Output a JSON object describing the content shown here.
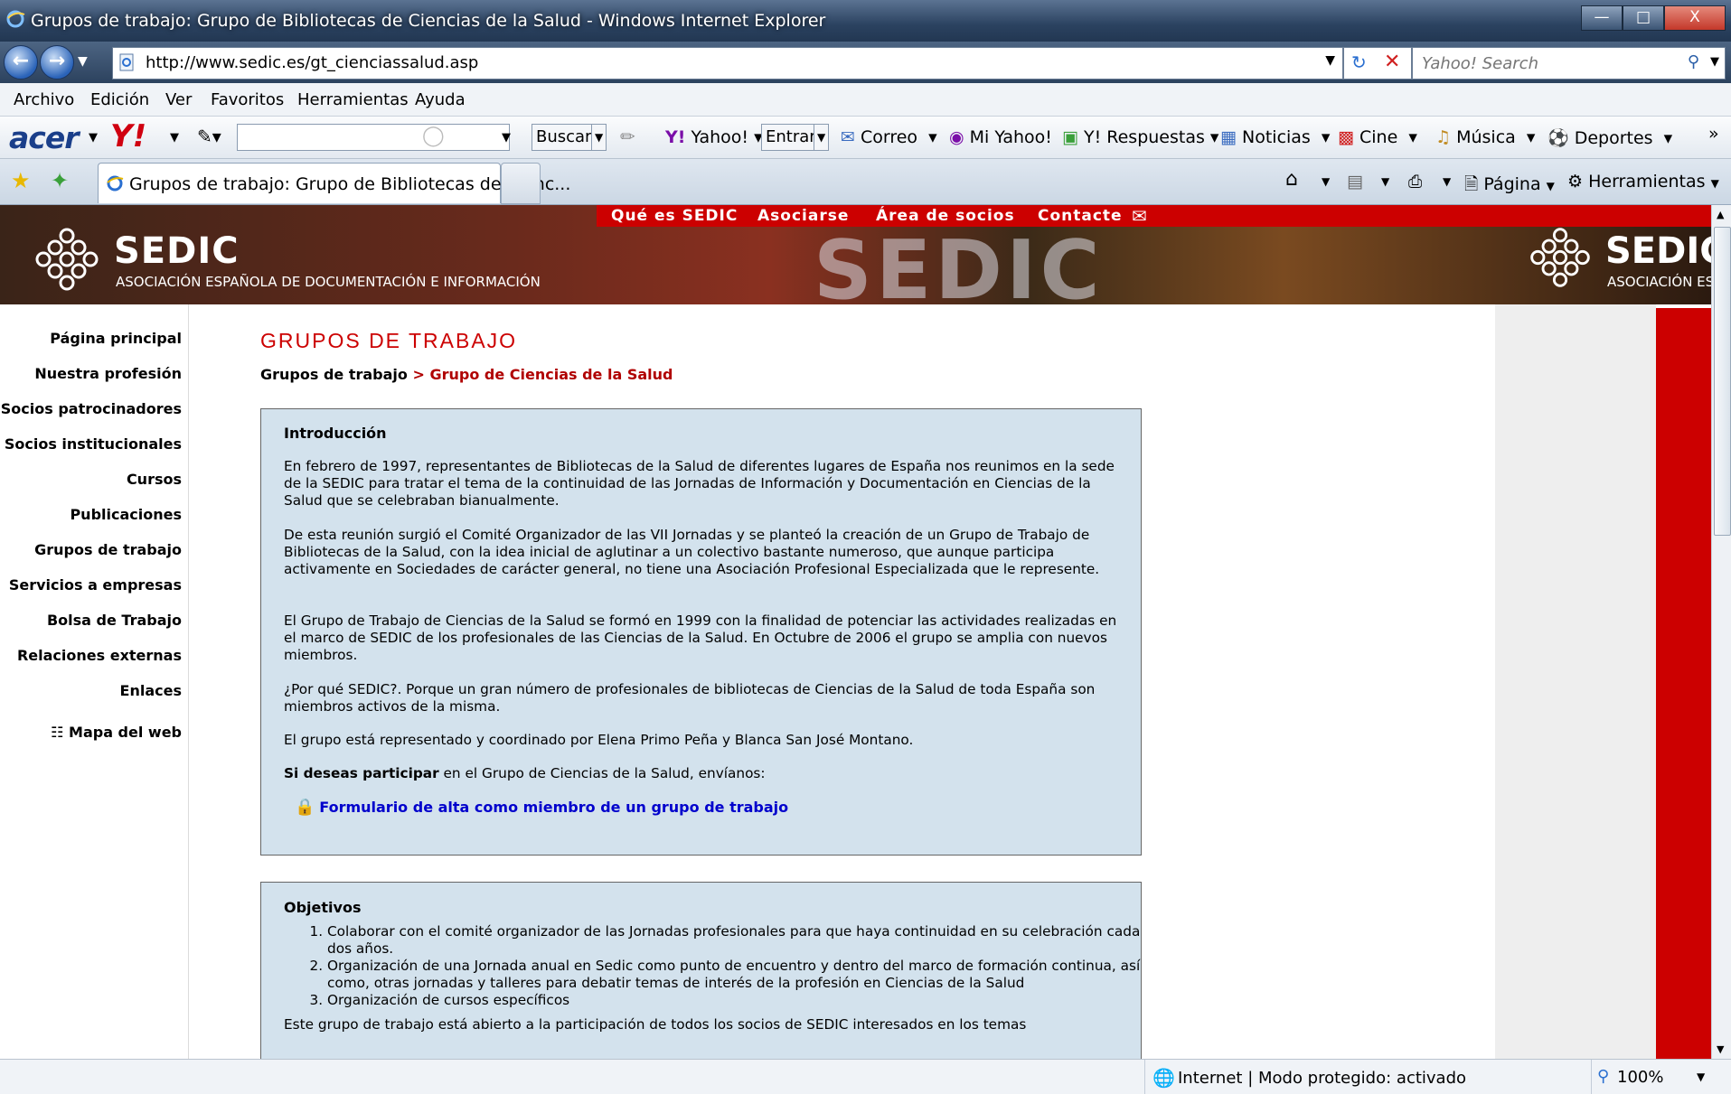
{
  "window": {
    "title": "Grupos de trabajo: Grupo de Bibliotecas de Ciencias de la Salud - Windows Internet Explorer"
  },
  "address": {
    "url": "http://www.sedic.es/gt_cienciassalud.asp",
    "search_placeholder": "Yahoo! Search"
  },
  "menu": {
    "items": [
      "Archivo",
      "Edición",
      "Ver",
      "Favoritos",
      "Herramientas",
      "Ayuda"
    ]
  },
  "toolbar": {
    "brand": "acer",
    "buscar": "Buscar",
    "yahoo": "Yahoo!",
    "entrar": "Entrar",
    "correo": "Correo",
    "mi_yahoo": "Mi Yahoo!",
    "respuestas": "Y! Respuestas",
    "noticias": "Noticias",
    "cine": "Cine",
    "musica": "Música",
    "deportes": "Deportes"
  },
  "tabs": {
    "active": "Grupos de trabajo: Grupo de Bibliotecas de Cienc...",
    "pagina": "Página",
    "herramientas": "Herramientas"
  },
  "site": {
    "logo_text": "SEDIC",
    "logo_subtitle": "ASOCIACIÓN ESPAÑOLA DE DOCUMENTACIÓN E INFORMACIÓN",
    "logo_subtitle_cut": "ASOCIACIÓN ES",
    "top_nav": [
      "Qué es SEDIC",
      "Asociarse",
      "Área de socios",
      "Contacte"
    ],
    "sidebar": [
      "Página principal",
      "Nuestra profesión",
      "Socios patrocinadores",
      "Socios institucionales",
      "Cursos",
      "Publicaciones",
      "Grupos de trabajo",
      "Servicios a empresas",
      "Bolsa de Trabajo",
      "Relaciones externas",
      "Enlaces"
    ],
    "sitemap": "Mapa del web"
  },
  "content": {
    "page_title": "GRUPOS DE TRABAJO",
    "breadcrumb_parent": "Grupos de trabajo",
    "breadcrumb_sep": ">",
    "breadcrumb_current": "Grupo de Ciencias de la Salud",
    "intro": {
      "heading": "Introducción",
      "paragraphs": [
        "En febrero de 1997, representantes de Bibliotecas de la Salud de diferentes lugares de España nos reunimos en la sede de la SEDIC para tratar el tema de la continuidad de las Jornadas de Información y Documentación en Ciencias de la Salud que se celebraban bianualmente.",
        "De esta reunión surgió el Comité Organizador de las VII Jornadas y se planteó la creación de un Grupo de Trabajo de Bibliotecas de la Salud, con la idea inicial de aglutinar a un colectivo bastante numeroso, que aunque participa activamente en Sociedades de carácter general, no tiene una Asociación Profesional Especializada que le represente.",
        "El Grupo de Trabajo de Ciencias de la Salud se formó en 1999 con la finalidad de potenciar las actividades realizadas en el marco de SEDIC de los profesionales de las Ciencias de la Salud. En Octubre de 2006 el grupo se amplia con nuevos miembros.",
        "¿Por qué SEDIC?. Porque un gran número de profesionales de bibliotecas de Ciencias de la Salud de toda España son miembros activos de la misma.",
        "El grupo está representado y coordinado por Elena Primo Peña y Blanca San José Montano."
      ],
      "participate_bold": "Si deseas participar",
      "participate_rest": " en el Grupo de Ciencias de la Salud, envíanos:",
      "form_link": "Formulario de alta como miembro de un grupo de trabajo"
    },
    "objectives": {
      "heading": "Objetivos",
      "items": [
        "Colaborar con el comité organizador de las Jornadas profesionales para que haya continuidad en su celebración cada dos años.",
        "Organización de una Jornada anual en Sedic como punto de encuentro y dentro del marco de formación continua, así como, otras jornadas y talleres para debatir temas de interés de la profesión en Ciencias de la Salud",
        "Organización de cursos específicos"
      ],
      "footer": "Este grupo de trabajo está abierto a la participación de todos los socios de SEDIC interesados en los temas"
    }
  },
  "status": {
    "zone": "Internet | Modo protegido: activado",
    "zoom": "100%"
  }
}
